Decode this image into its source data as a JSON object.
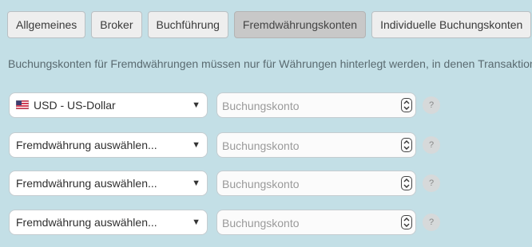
{
  "tabs": [
    {
      "label": "Allgemeines"
    },
    {
      "label": "Broker"
    },
    {
      "label": "Buchführung"
    },
    {
      "label": "Fremdwährungskonten",
      "active": true
    },
    {
      "label": "Individuelle Buchungskonten"
    }
  ],
  "intro_text": "Buchungskonten für Fremdwährungen müssen nur für Währungen hinterlegt werden, in denen Transaktion",
  "rows": [
    {
      "currency": "USD - US-Dollar",
      "flag": "us-flag-icon",
      "account_placeholder": "Buchungskonto",
      "help": "?"
    },
    {
      "currency": "Fremdwährung auswählen...",
      "account_placeholder": "Buchungskonto",
      "help": "?"
    },
    {
      "currency": "Fremdwährung auswählen...",
      "account_placeholder": "Buchungskonto",
      "help": "?"
    },
    {
      "currency": "Fremdwährung auswählen...",
      "account_placeholder": "Buchungskonto",
      "help": "?"
    }
  ],
  "caret_glyph": "▼",
  "colors": {
    "background": "#c3dfe6",
    "active_tab": "#c8c8c8",
    "tab": "#eeeeee"
  }
}
